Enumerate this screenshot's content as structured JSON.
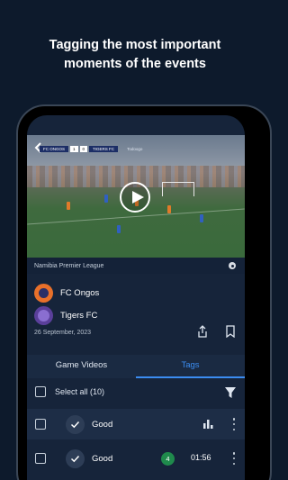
{
  "headline": {
    "line1": "Tagging the most important",
    "line2": "moments of the events"
  },
  "video": {
    "scoreboard": {
      "home_team": "FC ONGOS",
      "home_score": "1",
      "away_score": "0",
      "away_team": "TIGERS FC",
      "extra": "Todoogo"
    }
  },
  "match": {
    "league": "Namibia Premier League",
    "home_team": "FC Ongos",
    "away_team": "Tigers FC",
    "date": "26 September, 2023"
  },
  "tabs": [
    {
      "label": "Game Videos",
      "active": false
    },
    {
      "label": "Tags",
      "active": true
    }
  ],
  "list": {
    "select_all_label": "Select all (10)",
    "items": [
      {
        "label": "Good",
        "badge": "",
        "duration": ""
      },
      {
        "label": "Good",
        "badge": "4",
        "duration": "01:56"
      }
    ]
  },
  "colors": {
    "background": "#0d1a2c",
    "accent": "#3b8cf0",
    "badge_green": "#1f8a4c"
  }
}
